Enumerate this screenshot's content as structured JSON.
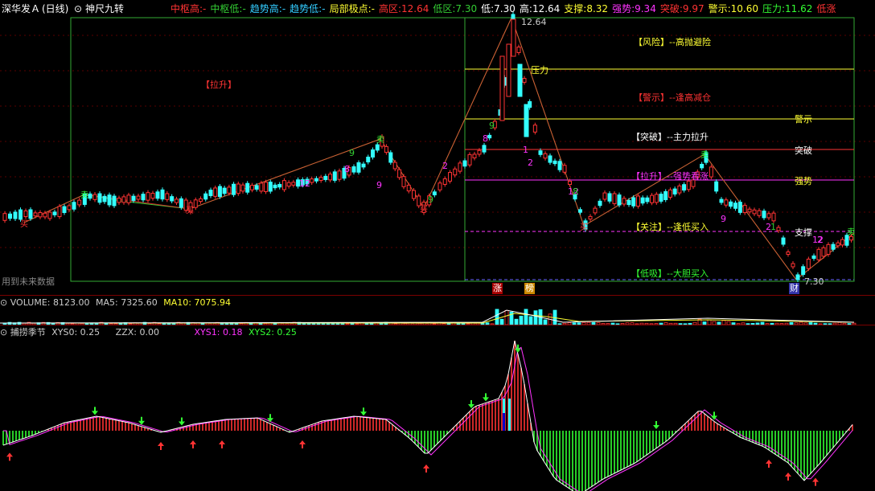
{
  "header": {
    "stock_name": "深华发Ａ",
    "period": "(日线)",
    "indicator": "神尺九转",
    "items": [
      {
        "label": "中枢高:",
        "value": "-",
        "color": "#ff3333"
      },
      {
        "label": "中枢低:",
        "value": "-",
        "color": "#33cc33"
      },
      {
        "label": "趋势高:",
        "value": "-",
        "color": "#33ccff"
      },
      {
        "label": "趋势低:",
        "value": "-",
        "color": "#33ccff"
      },
      {
        "label": "局部极点:",
        "value": "-",
        "color": "#ffff33"
      },
      {
        "label": "高区:",
        "value": "12.64",
        "color": "#ff3333"
      },
      {
        "label": "低区:",
        "value": "7.30",
        "color": "#33cc33"
      },
      {
        "label": "低:",
        "value": "7.30",
        "color": "#ffffff"
      },
      {
        "label": "高:",
        "value": "12.64",
        "color": "#ffffff"
      },
      {
        "label": "支撑:",
        "value": "8.32",
        "color": "#ffff33"
      },
      {
        "label": "强势:",
        "value": "9.34",
        "color": "#ff33ff"
      },
      {
        "label": "突破:",
        "value": "9.97",
        "color": "#ff3333"
      },
      {
        "label": "警示:",
        "value": "10.60",
        "color": "#ffff33"
      },
      {
        "label": "压力:",
        "value": "11.62",
        "color": "#33ff33"
      },
      {
        "label": "低涨",
        "value": "",
        "color": "#ff3333"
      }
    ]
  },
  "main_chart": {
    "label_lashen": "【拉升】",
    "future_data_note": "用到未来数据",
    "price_high": "12.64",
    "price_low": "7.30",
    "right_zone": [
      {
        "label": "【风险】--高抛避险",
        "color": "#ffff33"
      },
      {
        "label": "【警示】--逢高减仓",
        "color": "#ff3333"
      },
      {
        "label": "【突破】--主力拉升",
        "color": "#ffffff"
      },
      {
        "label": "【拉升】--强势看涨",
        "color": "#ff33ff"
      },
      {
        "label": "【关注】--逢低买入",
        "color": "#ffff33"
      },
      {
        "label": "【低吸】--大胆买入",
        "color": "#33ff33"
      }
    ],
    "level_labels": {
      "yali": "压力",
      "jingshi": "警示",
      "tupo": "突破",
      "qiangshi": "强势",
      "zhicheng": "支撑"
    },
    "bottom_tags": [
      {
        "text": "涨",
        "bg": "#aa0000",
        "color": "#ffffff"
      },
      {
        "text": "榜",
        "bg": "#cc8800",
        "color": "#ffffff"
      },
      {
        "text": "财",
        "bg": "#3333aa",
        "color": "#ffffff"
      }
    ],
    "count_labels": [
      "9",
      "8",
      "12",
      "9",
      "9",
      "2",
      "8",
      "9",
      "1",
      "2",
      "12",
      "8",
      "9",
      "2",
      "1",
      "2",
      "12",
      "1",
      "9",
      "2"
    ],
    "buy_tag": "买",
    "sell_tag": "卖"
  },
  "volume": {
    "title": "VOLUME:",
    "value": "8123.00",
    "ma5_label": "MA5:",
    "ma5": "7325.60",
    "ma10_label": "MA10:",
    "ma10": "7075.94"
  },
  "indicator": {
    "title": "捕捞季节",
    "xys0_label": "XYS0:",
    "xys0": "0.25",
    "zzx_label": "ZZX:",
    "zzx": "0.00",
    "xys1_label": "XYS1:",
    "xys1": "0.18",
    "xys2_label": "XYS2:",
    "xys2": "0.25"
  },
  "colors": {
    "up": "#ff3333",
    "down": "#33ffff",
    "frame_green": "#33cc33",
    "yellow": "#ffff33",
    "magenta": "#ff33ff",
    "grid": "#7a0000"
  }
}
